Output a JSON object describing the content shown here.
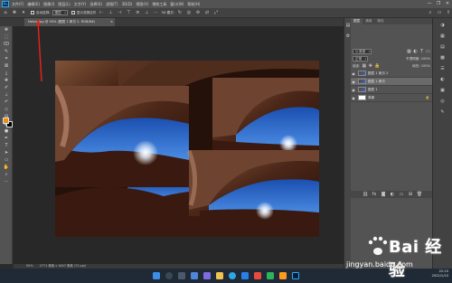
{
  "app": {
    "logo": "Ps",
    "menu": [
      "文件(F)",
      "编辑(E)",
      "图像(I)",
      "图层(L)",
      "文字(Y)",
      "选择(S)",
      "滤镜(T)",
      "3D(D)",
      "视图(V)",
      "增效工具",
      "窗口(W)",
      "帮助(H)"
    ],
    "window_buttons": [
      "—",
      "❐",
      "✕"
    ]
  },
  "options": {
    "auto_select_label": "自动选择:",
    "auto_select_value": "图层",
    "transform_label": "显示变换控件",
    "mode_label": "3D 模式:"
  },
  "document": {
    "tab_title": "Nelsio.jpg @ 50% (图层 1 拷贝 2, RGB/8#)",
    "close": "×"
  },
  "status": {
    "zoom": "50%",
    "info": "2771 像素 x 1847 像素 (72 ppi)"
  },
  "layers_panel": {
    "tabs": [
      "图层",
      "通道",
      "路径"
    ],
    "kind_label": "Q 类型",
    "blend_mode": "正常",
    "opacity_label": "不透明度: 100%",
    "lock_label": "锁定:",
    "fill_label": "填充: 100%",
    "layers": [
      {
        "name": "图层 1 拷贝 2",
        "selected": false,
        "mask": false
      },
      {
        "name": "图层 1 拷贝",
        "selected": true,
        "mask": false
      },
      {
        "name": "图层 1",
        "selected": false,
        "mask": false
      },
      {
        "name": "背景",
        "selected": false,
        "mask": true
      }
    ],
    "footer_icons": [
      "link-icon",
      "fx-icon",
      "mask-icon",
      "adjust-icon",
      "group-icon",
      "new-layer-icon",
      "trash-icon"
    ]
  },
  "tools": [
    "move-tool",
    "marquee-tool",
    "lasso-tool",
    "quick-select-tool",
    "crop-tool",
    "frame-tool",
    "eyedropper-tool",
    "healing-tool",
    "brush-tool",
    "stamp-tool",
    "history-brush-tool",
    "eraser-tool",
    "gradient-tool",
    "blur-tool",
    "dodge-tool",
    "pen-tool",
    "type-tool",
    "path-select-tool",
    "shape-tool",
    "hand-tool",
    "zoom-tool",
    "more-tool"
  ],
  "colors": {
    "foreground": "#f28c0f",
    "background": "#000000",
    "accent": "#31a8ff",
    "annotation_arrow": "#e0241b"
  },
  "taskbar": {
    "time": "22:10",
    "date": "2022/1/10"
  },
  "watermark": {
    "brand": "Bai 经验",
    "url": "jingyan.baidu.com"
  }
}
